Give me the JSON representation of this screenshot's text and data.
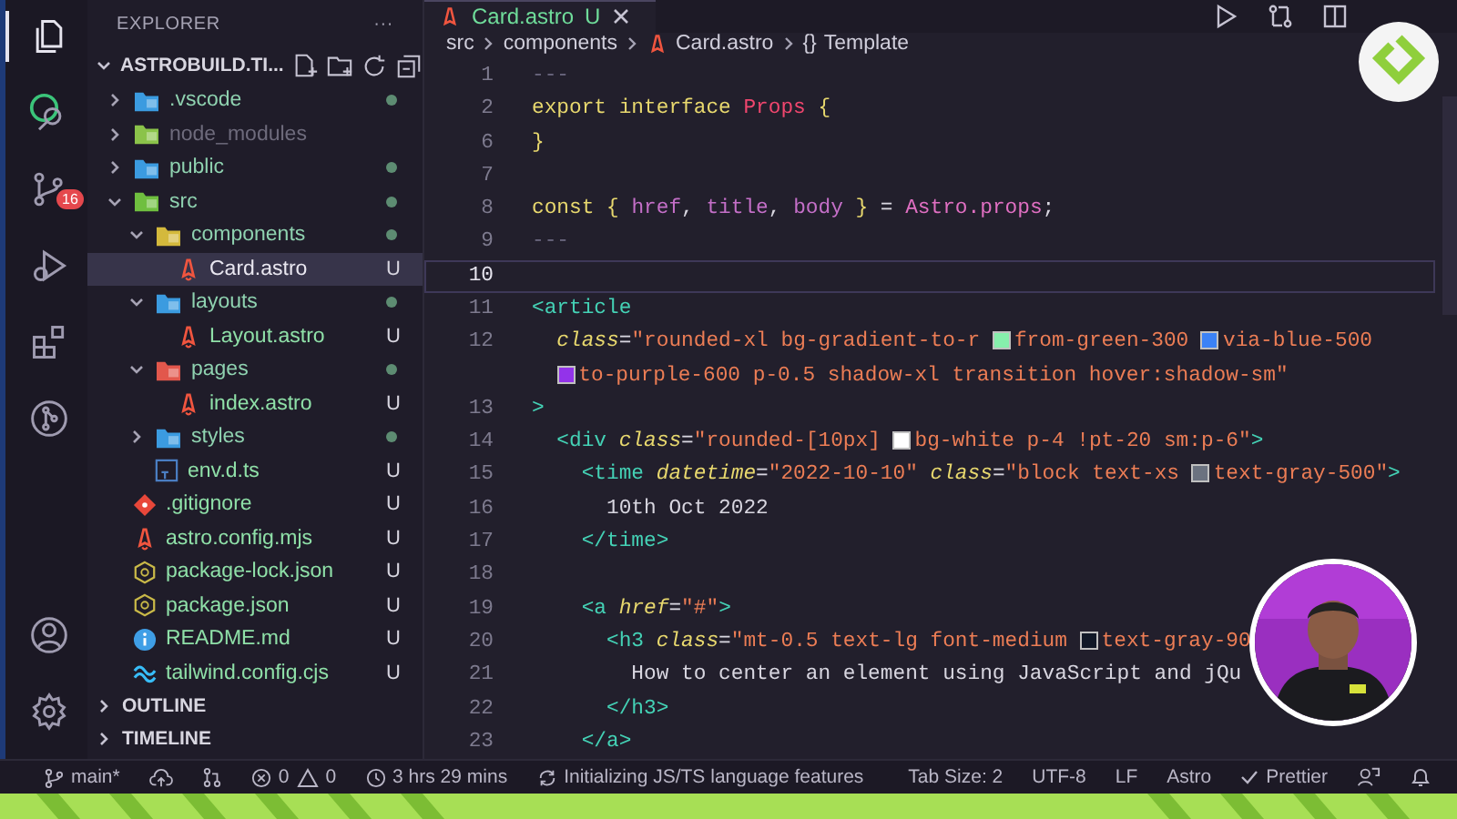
{
  "activity_bar": {
    "top": [
      {
        "kind": "files",
        "selected": true
      },
      {
        "kind": "search",
        "selected": false
      },
      {
        "kind": "scm",
        "selected": false,
        "badge": "16"
      },
      {
        "kind": "debug",
        "selected": false
      },
      {
        "kind": "extensions",
        "selected": false
      },
      {
        "kind": "graph",
        "selected": false
      }
    ],
    "bottom": [
      {
        "kind": "account",
        "selected": false
      },
      {
        "kind": "settings",
        "selected": false
      }
    ]
  },
  "sidebar": {
    "title": "EXPLORER",
    "more": "···",
    "folder": {
      "name": "ASTROBUILD.TI...",
      "expanded": true
    },
    "tree": [
      {
        "name": ".vscode",
        "kind": "folder",
        "color": "#3b9be0",
        "expanded": false,
        "dot": true,
        "ignored": false,
        "selected": false
      },
      {
        "name": "node_modules",
        "kind": "folder",
        "color": "#8bc34a",
        "expanded": false,
        "dot": false,
        "ignored": true,
        "selected": false
      },
      {
        "name": "public",
        "kind": "folder",
        "color": "#3b9be0",
        "expanded": false,
        "dot": true,
        "ignored": false,
        "selected": false
      },
      {
        "name": "src",
        "kind": "folder",
        "color": "#6fbf3f",
        "expanded": true,
        "dot": true,
        "ignored": false,
        "selected": false,
        "children": [
          {
            "name": "components",
            "kind": "folder",
            "color": "#d4b93c",
            "expanded": true,
            "dot": true,
            "ignored": false,
            "selected": false,
            "children": [
              {
                "name": "Card.astro",
                "kind": "astro",
                "badge": "U",
                "dot": false,
                "ignored": false,
                "selected": true
              }
            ]
          },
          {
            "name": "layouts",
            "kind": "folder",
            "color": "#3b9be0",
            "expanded": true,
            "dot": true,
            "ignored": false,
            "selected": false,
            "children": [
              {
                "name": "Layout.astro",
                "kind": "astro",
                "badge": "U",
                "dot": false,
                "ignored": false,
                "selected": false
              }
            ]
          },
          {
            "name": "pages",
            "kind": "folder",
            "color": "#e2574c",
            "expanded": true,
            "dot": true,
            "ignored": false,
            "selected": false,
            "children": [
              {
                "name": "index.astro",
                "kind": "astro",
                "badge": "U",
                "dot": false,
                "ignored": false,
                "selected": false
              }
            ]
          },
          {
            "name": "styles",
            "kind": "folder",
            "color": "#3b9be0",
            "expanded": false,
            "dot": true,
            "ignored": false,
            "selected": false
          },
          {
            "name": "env.d.ts",
            "kind": "ts",
            "badge": "U",
            "dot": false,
            "ignored": false,
            "selected": false
          }
        ]
      },
      {
        "name": ".gitignore",
        "kind": "git",
        "badge": "U",
        "dot": false,
        "ignored": false,
        "selected": false
      },
      {
        "name": "astro.config.mjs",
        "kind": "astro",
        "badge": "U",
        "dot": false,
        "ignored": false,
        "selected": false
      },
      {
        "name": "package-lock.json",
        "kind": "json",
        "badge": "U",
        "dot": false,
        "ignored": false,
        "selected": false
      },
      {
        "name": "package.json",
        "kind": "json",
        "badge": "U",
        "dot": false,
        "ignored": false,
        "selected": false
      },
      {
        "name": "README.md",
        "kind": "info",
        "badge": "U",
        "dot": false,
        "ignored": false,
        "selected": false
      },
      {
        "name": "tailwind.config.cjs",
        "kind": "tailwind",
        "badge": "U",
        "dot": false,
        "ignored": false,
        "selected": false
      }
    ],
    "sections": [
      {
        "name": "OUTLINE",
        "expanded": false
      },
      {
        "name": "TIMELINE",
        "expanded": false
      }
    ]
  },
  "editor": {
    "tab": {
      "name": "Card.astro",
      "badge": "U",
      "selected": true
    },
    "breadcrumbs": [
      {
        "text": "src",
        "kind": "folder"
      },
      {
        "text": "components",
        "kind": "folder"
      },
      {
        "text": "Card.astro",
        "kind": "file"
      },
      {
        "text": "Template",
        "kind": "symbol",
        "symbol": "{}"
      }
    ],
    "lines": [
      {
        "number": "1",
        "current": false,
        "tokens": [
          {
            "kind": "comment",
            "text": "---"
          }
        ]
      },
      {
        "number": "2",
        "current": false,
        "tokens": [
          {
            "kind": "kw",
            "text": "export interface "
          },
          {
            "kind": "type",
            "text": "Props"
          },
          {
            "kind": "kw",
            "text": " {"
          }
        ]
      },
      {
        "number": "6",
        "current": false,
        "tokens": [
          {
            "kind": "kw",
            "text": "}"
          }
        ]
      },
      {
        "number": "7",
        "current": false
      },
      {
        "number": "8",
        "current": false,
        "tokens": [
          {
            "kind": "kw",
            "text": "const { "
          },
          {
            "kind": "var",
            "text": "href"
          },
          {
            "kind": "text",
            "text": ", "
          },
          {
            "kind": "var",
            "text": "title"
          },
          {
            "kind": "text",
            "text": ", "
          },
          {
            "kind": "var",
            "text": "body"
          },
          {
            "kind": "kw",
            "text": " }"
          },
          {
            "kind": "text",
            "text": " = "
          },
          {
            "kind": "obj",
            "text": "Astro.props"
          },
          {
            "kind": "text",
            "text": ";"
          }
        ]
      },
      {
        "number": "9",
        "current": false,
        "tokens": [
          {
            "kind": "comment",
            "text": "---"
          }
        ]
      },
      {
        "number": "10",
        "current": true
      },
      {
        "number": "11",
        "current": false,
        "tokens": [
          {
            "kind": "tag",
            "text": "<article"
          }
        ]
      },
      {
        "number": "12",
        "current": false,
        "tokens": [
          {
            "kind": "attr",
            "text": "  class"
          },
          {
            "kind": "text",
            "text": "="
          },
          {
            "kind": "str",
            "text": "\"rounded-xl bg-gradient-to-r "
          },
          {
            "kind": "swatch",
            "color": "#86efac"
          },
          {
            "kind": "str",
            "text": "from-green-300 "
          },
          {
            "kind": "swatch",
            "color": "#3b82f6"
          },
          {
            "kind": "str",
            "text": "via-blue-500"
          }
        ]
      },
      {
        "current": false,
        "tokens": [
          {
            "kind": "swatch",
            "color": "#9333ea"
          },
          {
            "kind": "str",
            "text": "to-purple-600 p-0.5 shadow-xl transition hover:shadow-sm\""
          }
        ]
      },
      {
        "number": "13",
        "current": false,
        "tokens": [
          {
            "kind": "tag",
            "text": ">"
          }
        ]
      },
      {
        "number": "14",
        "current": false,
        "tokens": [
          {
            "kind": "tag",
            "text": "  <div "
          },
          {
            "kind": "attr",
            "text": "class"
          },
          {
            "kind": "text",
            "text": "="
          },
          {
            "kind": "str",
            "text": "\"rounded-[10px] "
          },
          {
            "kind": "swatch",
            "color": "#ffffff"
          },
          {
            "kind": "str",
            "text": "bg-white p-4 !pt-20 sm:p-6\""
          },
          {
            "kind": "tag",
            "text": ">"
          }
        ]
      },
      {
        "number": "15",
        "current": false,
        "tokens": [
          {
            "kind": "tag",
            "text": "    <time "
          },
          {
            "kind": "attr",
            "text": "datetime"
          },
          {
            "kind": "text",
            "text": "="
          },
          {
            "kind": "str",
            "text": "\"2022-10-10\" "
          },
          {
            "kind": "attr",
            "text": "class"
          },
          {
            "kind": "text",
            "text": "="
          },
          {
            "kind": "str",
            "text": "\"block text-xs "
          },
          {
            "kind": "swatch",
            "color": "#6b7280"
          },
          {
            "kind": "str",
            "text": "text-gray-500\""
          },
          {
            "kind": "tag",
            "text": ">"
          }
        ]
      },
      {
        "number": "16",
        "current": false,
        "tokens": [
          {
            "kind": "text",
            "text": "      10th Oct 2022"
          }
        ]
      },
      {
        "number": "17",
        "current": false,
        "tokens": [
          {
            "kind": "tag",
            "text": "    </time>"
          }
        ]
      },
      {
        "number": "18",
        "current": false
      },
      {
        "number": "19",
        "current": false,
        "tokens": [
          {
            "kind": "tag",
            "text": "    <a "
          },
          {
            "kind": "attr",
            "text": "href"
          },
          {
            "kind": "text",
            "text": "="
          },
          {
            "kind": "str",
            "text": "\"#\""
          },
          {
            "kind": "tag",
            "text": ">"
          }
        ]
      },
      {
        "number": "20",
        "current": false,
        "tokens": [
          {
            "kind": "tag",
            "text": "      <h3 "
          },
          {
            "kind": "attr",
            "text": "class"
          },
          {
            "kind": "text",
            "text": "="
          },
          {
            "kind": "str",
            "text": "\"mt-0.5 text-lg font-medium "
          },
          {
            "kind": "swatch",
            "color": "#111827"
          },
          {
            "kind": "str",
            "text": "text-gray-90"
          }
        ]
      },
      {
        "number": "21",
        "current": false,
        "tokens": [
          {
            "kind": "text",
            "text": "        How to center an element using JavaScript and jQu"
          }
        ]
      },
      {
        "number": "22",
        "current": false,
        "tokens": [
          {
            "kind": "tag",
            "text": "      </h3>"
          }
        ]
      },
      {
        "number": "23",
        "current": false,
        "tokens": [
          {
            "kind": "tag",
            "text": "    </a>"
          }
        ]
      }
    ]
  },
  "status_bar": {
    "left": [
      {
        "kind": "branch",
        "text": "main*"
      },
      {
        "kind": "sync"
      },
      {
        "kind": "pr"
      },
      {
        "kind": "problems",
        "errors": "0",
        "warnings": "0"
      },
      {
        "kind": "clock",
        "text": "3 hrs 29 mins"
      },
      {
        "kind": "loading",
        "text": "Initializing JS/TS language features"
      }
    ],
    "right": [
      {
        "kind": "text",
        "text": "Tab Size: 2"
      },
      {
        "kind": "text",
        "text": "UTF-8"
      },
      {
        "kind": "text",
        "text": "LF"
      },
      {
        "kind": "text",
        "text": "Astro"
      },
      {
        "kind": "check",
        "text": "Prettier"
      },
      {
        "kind": "feedback"
      },
      {
        "kind": "bell"
      }
    ]
  }
}
